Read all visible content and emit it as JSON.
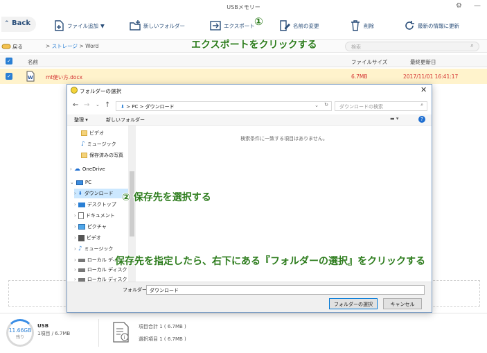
{
  "window": {
    "title": "USBメモリー"
  },
  "toolbar": {
    "back_label": "Back",
    "add_file": "ファイル追加",
    "new_folder": "新しいフォルダー",
    "export": "エクスポート",
    "rename": "名前の変更",
    "delete": "削除",
    "refresh": "最新の情報に更新"
  },
  "pathbar": {
    "up_label": "戻る",
    "crumb_storage": "ストレージ",
    "crumb_current": "Word",
    "crumb_sep": ">",
    "search_placeholder": "検索"
  },
  "list": {
    "columns": {
      "name": "名前",
      "size": "ファイルサイズ",
      "modified": "最終更新日"
    },
    "rows": [
      {
        "name": "mt使い方.docx",
        "size": "6.7MB",
        "modified": "2017/11/01 16:41:17"
      }
    ]
  },
  "annotations": {
    "step1_marker": "①",
    "step1": "エクスポートをクリックする",
    "step2": "② 保存先を選択する",
    "step3": "保存先を指定したら、右下にある『フォルダーの選択』をクリックする",
    "color": "#2e7d1e"
  },
  "dialog": {
    "title": "フォルダーの選択",
    "address": {
      "root": "PC",
      "current": "ダウンロード",
      "sep": ">"
    },
    "search_placeholder": "ダウンロードの検索",
    "organize": "整理 ▾",
    "new_folder": "新しいフォルダー",
    "empty_message": "検索条件に一致する項目はありません。",
    "tree": [
      {
        "label": "ビデオ",
        "icon": "folder-icon"
      },
      {
        "label": "ミュージック",
        "icon": "music-icon"
      },
      {
        "label": "保存済みの写真",
        "icon": "folder-icon"
      },
      {
        "label": "OneDrive",
        "icon": "cloud-icon"
      },
      {
        "label": "PC",
        "icon": "computer-icon"
      },
      {
        "label": "ダウンロード",
        "icon": "download-icon"
      },
      {
        "label": "デスクトップ",
        "icon": "desktop-icon"
      },
      {
        "label": "ドキュメント",
        "icon": "document-icon"
      },
      {
        "label": "ピクチャ",
        "icon": "picture-icon"
      },
      {
        "label": "ビデオ",
        "icon": "video-icon"
      },
      {
        "label": "ミュージック",
        "icon": "music-icon"
      },
      {
        "label": "ローカル ディスク",
        "icon": "drive-icon"
      },
      {
        "label": "ローカル ディスク",
        "icon": "drive-icon"
      },
      {
        "label": "ローカル ディスク (F",
        "icon": "drive-icon"
      }
    ],
    "folder_label": "フォルダー:",
    "folder_value": "ダウンロード",
    "select_button": "フォルダーの選択",
    "cancel_button": "キャンセル"
  },
  "status": {
    "capacity": "11.66GB",
    "remaining": "残り",
    "drive_name": "USB",
    "drive_items": "1項目 / 6.7MB",
    "total": "項目合計 1 ( 6.7MB )",
    "selected": "選択項目 1 ( 6.7MB )"
  },
  "colors": {
    "accent": "#2a7fd4",
    "selected_row": "#fff3cc",
    "brand": "#2b4f7a"
  }
}
